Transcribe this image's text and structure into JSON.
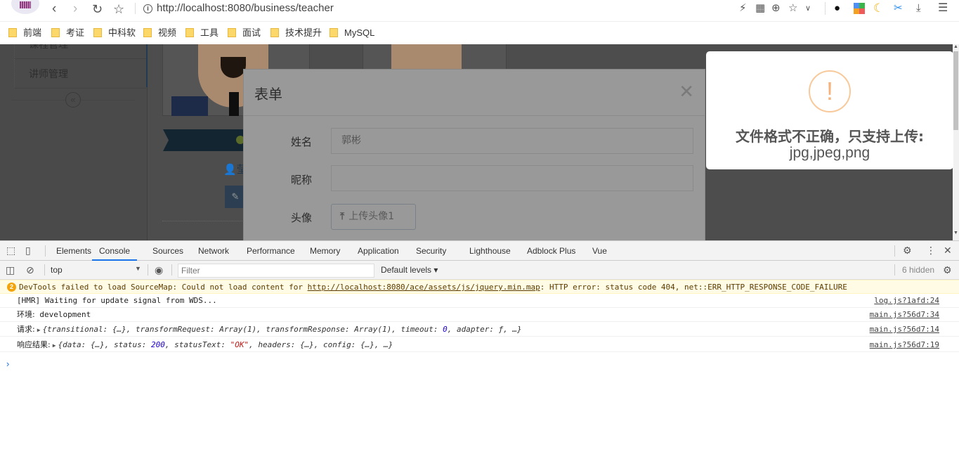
{
  "browser": {
    "url": "http://localhost:8080/business/teacher",
    "icons": [
      "back-icon",
      "forward-icon",
      "reload-icon",
      "bookmark-star-icon",
      "info-icon"
    ],
    "bookmarks": [
      "前端",
      "考证",
      "中科软",
      "视频",
      "工具",
      "面试",
      "技术提升",
      "MySQL"
    ]
  },
  "sidebar": {
    "items": [
      {
        "label": "课程管理"
      },
      {
        "label": "讲师管理"
      }
    ],
    "collapse_glyph": "«"
  },
  "teacher_card": {
    "name_partial": "莹"
  },
  "modal": {
    "title": "表单",
    "close_glyph": "✕",
    "fields": [
      {
        "label": "姓名",
        "value": "郭彬",
        "placeholder": ""
      },
      {
        "label": "昵称",
        "value": "",
        "placeholder": ""
      },
      {
        "label": "头像",
        "button": "上传头像1"
      }
    ]
  },
  "alert": {
    "icon": "!",
    "message": "文件格式不正确，只支持上传:",
    "formats": "jpg,jpeg,png",
    "accent_color": "#f8bb86"
  },
  "devtools": {
    "tabs": [
      "Elements",
      "Console",
      "Sources",
      "Network",
      "Performance",
      "Memory",
      "Application",
      "Security",
      "Lighthouse",
      "Adblock Plus",
      "Vue"
    ],
    "active_tab": "Console",
    "context": "top",
    "filter_placeholder": "Filter",
    "levels": "Default levels",
    "hidden_count": "6 hidden",
    "warning": {
      "count": "2",
      "text_before": "DevTools failed to load SourceMap: Could not load content for ",
      "link": "http://localhost:8080/ace/assets/js/jquery.min.map",
      "text_after": ": HTTP error: status code 404, net::ERR_HTTP_RESPONSE_CODE_FAILURE"
    },
    "messages": [
      {
        "prefix": "[HMR] Waiting for update signal from WDS...",
        "source": "log.js?1afd:24"
      },
      {
        "prefix": "环境:",
        "value": "development",
        "source": "main.js?56d7:34"
      },
      {
        "prefix": "请求:",
        "obj_a": "{transitional: {…}, transformRequest: Array(1), transformResponse: Array(1), timeout: ",
        "num": "0",
        "obj_b": ", adapter: ƒ, …}",
        "source": "main.js?56d7:14"
      },
      {
        "prefix": "响应结果:",
        "obj_a": "{data: {…}, status: ",
        "num": "200",
        "obj_mid": ", statusText: ",
        "str": "\"OK\"",
        "obj_b": ", headers: {…}, config: {…}, …}",
        "source": "main.js?56d7:19"
      }
    ],
    "prompt": "›"
  }
}
